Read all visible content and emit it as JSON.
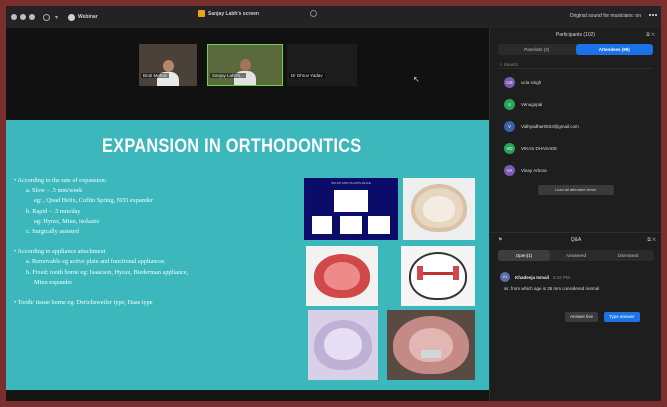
{
  "topbar": {
    "app_title": "Webinar",
    "screen_share_title": "Sanjay Labh's screen",
    "original_sound": "Original sound for musicians: on"
  },
  "videos": [
    {
      "name": "Bruti Mohan"
    },
    {
      "name": "Sanjay Labh's..."
    },
    {
      "name": "Dr Dhruv Yadav"
    }
  ],
  "slide": {
    "title": "EXPANSION IN ORTHODONTICS",
    "lines": [
      {
        "level": 1,
        "text": "• According to the rate of expansion:"
      },
      {
        "level": 2,
        "text": "a. Slow  –  .5 mm/week"
      },
      {
        "level": 3,
        "text": "eg: , Quad Helix, Coffin Spring, NiTi expander"
      },
      {
        "level": 2,
        "text": "b. Rapid  – .5 mm/day"
      },
      {
        "level": 3,
        "text": "eg: Hyrax, Minn, isolastic"
      },
      {
        "level": 2,
        "text": "c. Surgically assisted"
      },
      {
        "level": 0,
        "text": ""
      },
      {
        "level": 1,
        "text": "• According to appliance attachment"
      },
      {
        "level": 2,
        "text": "a. Removable eg active plate and functional appliances"
      },
      {
        "level": 2,
        "text": "b. Fixed: tooth borne eg: Isaacson, Hyrax, Biederman appliance,"
      },
      {
        "level": 3,
        "text": "Minn expander"
      },
      {
        "level": 0,
        "text": ""
      },
      {
        "level": 1,
        "text": "• Tooth/ tissue borne eg: Derichsweiler type, Haas type"
      }
    ],
    "figure_caption": "SPLINT MOUTH APPLIANCE"
  },
  "panel": {
    "participants_title": "Participants (102)",
    "tab_panelists": "Panelists (3)",
    "tab_attendees": "Attendees (99)",
    "search_placeholder": "Search",
    "attendees": [
      {
        "initials": "US",
        "name": "ucia singh",
        "color": "#7b5ab5"
      },
      {
        "initials": "V",
        "name": "Venugopal",
        "color": "#2aa35a"
      },
      {
        "initials": "V",
        "name": "Vidhyadhar0503@gmail.com",
        "color": "#3b5fa8"
      },
      {
        "initials": "VD",
        "name": "VIKAS DHASADE",
        "color": "#2aa35a"
      },
      {
        "initials": "VA",
        "name": "Vinay Arbora",
        "color": "#7b5ab5"
      }
    ],
    "load_more": "Load all attendee items",
    "qa_title": "Q&A",
    "qa_tabs": [
      "Open(1)",
      "Answered",
      "Dismissed"
    ],
    "question": {
      "initials": "KI",
      "author": "Khadeeja Ismail",
      "time": "5:16 PM",
      "text": "sir, from which age is 35 mm considered normal"
    },
    "answer_live": "Answer live",
    "type_answer": "Type answer"
  }
}
